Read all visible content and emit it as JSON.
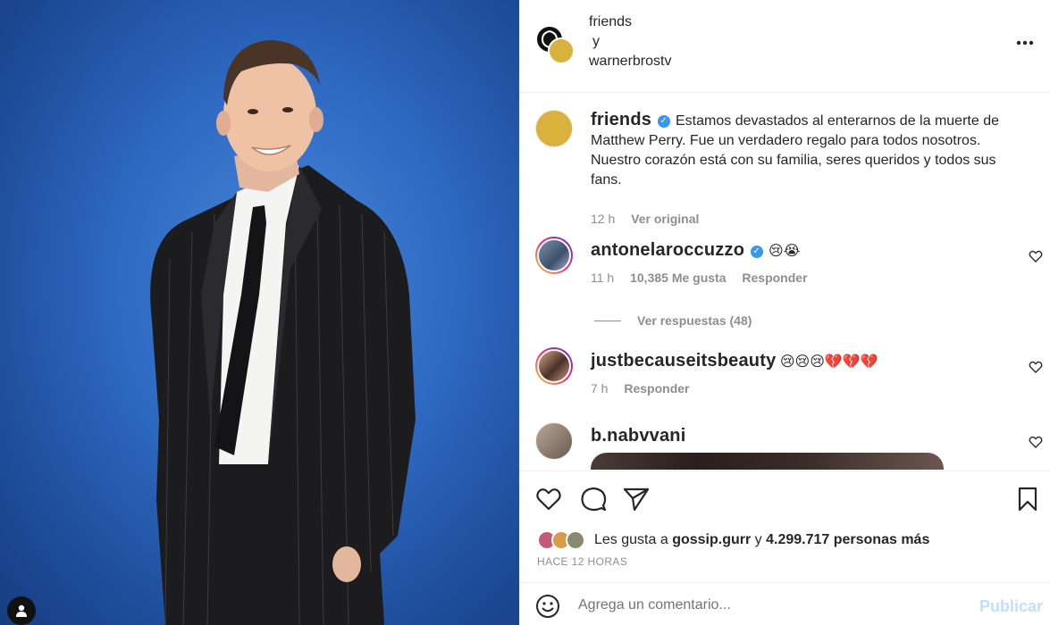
{
  "header": {
    "owner": "friends",
    "joiner": "y",
    "collaborator": "warnerbrostv",
    "more_icon": "more-horizontal-icon"
  },
  "caption": {
    "username": "friends",
    "verified": true,
    "text": "Estamos devastados al enterarnos de la muerte de Matthew Perry. Fue un verdadero regalo para todos nosotros. Nuestro corazón está con su familia, seres queridos y todos sus fans.",
    "time": "12 h",
    "see_original": "Ver original"
  },
  "comments": [
    {
      "username": "antonelaroccuzzo",
      "verified": true,
      "text": "😢😭",
      "time": "11 h",
      "likes": "10,385 Me gusta",
      "reply": "Responder",
      "view_replies": "Ver respuestas (48)"
    },
    {
      "username": "justbecauseitsbeauty",
      "verified": false,
      "text": "😢😢😢💔💔💔",
      "time": "7 h",
      "reply": "Responder"
    },
    {
      "username": "b.nabvvani",
      "verified": false,
      "text": ""
    }
  ],
  "actions": {
    "likes_prefix": "Les gusta a",
    "likes_user": "gossip.gurr",
    "likes_joiner": "y",
    "likes_count": "4.299.717 personas más",
    "posted_ago": "HACE 12 HORAS"
  },
  "add_comment": {
    "placeholder": "Agrega un comentario...",
    "publish": "Publicar"
  },
  "colors": {
    "accent": "#0095f6",
    "verified": "#3897f0",
    "muted": "#8e8e8e",
    "publish_disabled": "#c0dffd"
  }
}
